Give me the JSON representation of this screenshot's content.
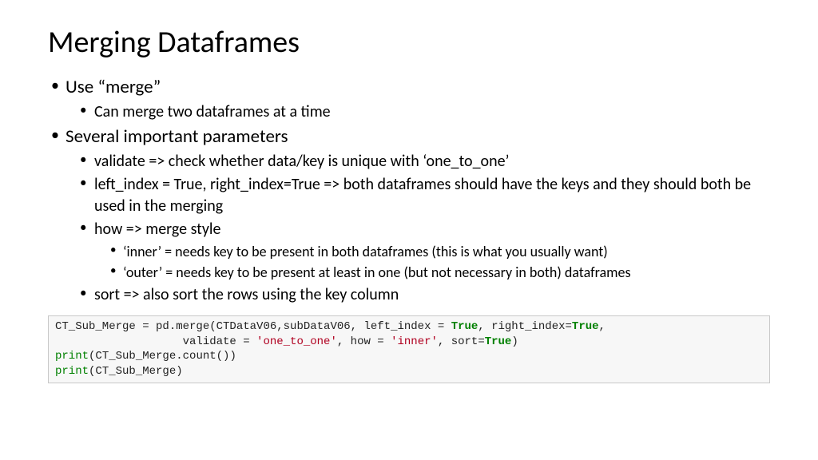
{
  "title": "Merging Dataframes",
  "b1": "Use “merge”",
  "b1_1": "Can merge two dataframes at a time",
  "b2": "Several important parameters",
  "b2_1": "validate => check whether data/key is unique with ‘one_to_one’",
  "b2_2": "left_index = True, right_index=True => both dataframes should have the keys and they should both be used in the merging",
  "b2_3": "how => merge style",
  "b2_3_1": "‘inner’ = needs key to be present in both dataframes (this is what you usually want)",
  "b2_3_2": "‘outer’ = needs key to be present at least in one (but not necessary in both) dataframes",
  "b2_4": "sort => also sort the rows using the key column",
  "code": {
    "l1a": "CT_Sub_Merge = pd.merge(CTDataV06,subDataV06, left_index = ",
    "true1": "True",
    "l1b": ", right_index=",
    "true2": "True",
    "l1c": ",",
    "l2a": "                   validate = ",
    "str1": "'one_to_one'",
    "l2b": ", how = ",
    "str2": "'inner'",
    "l2c": ", sort=",
    "true3": "True",
    "l2d": ")",
    "print": "print",
    "l3": "(CT_Sub_Merge.count())",
    "l4": "(CT_Sub_Merge)"
  }
}
